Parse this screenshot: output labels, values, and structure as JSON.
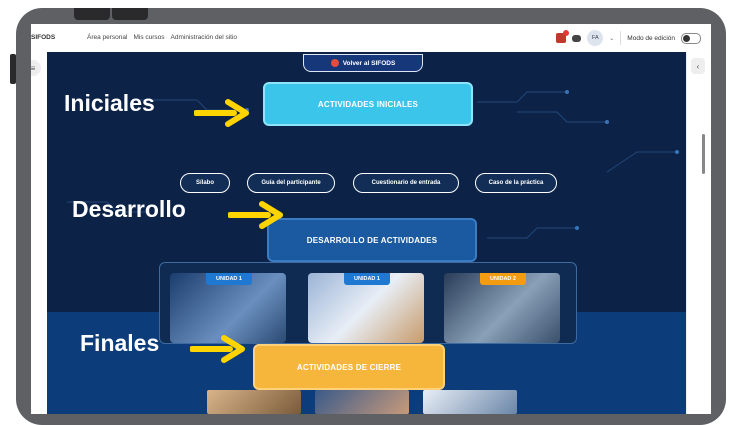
{
  "app": {
    "brand": "SIFODS"
  },
  "nav": {
    "items": [
      "Área personal",
      "Mis cursos",
      "Administración del sitio"
    ]
  },
  "header": {
    "avatar_initials": "FA",
    "edit_mode_label": "Modo de edición"
  },
  "banner": {
    "back_label": "Volver al SIFODS"
  },
  "sections": {
    "iniciales": {
      "title": "ACTIVIDADES INICIALES",
      "annotation": "Iniciales"
    },
    "desarrollo": {
      "title": "DESARROLLO DE ACTIVIDADES",
      "annotation": "Desarrollo"
    },
    "finales": {
      "title": "ACTIVIDADES DE CIERRE",
      "annotation": "Finales"
    }
  },
  "quick_links": [
    "Sílabo",
    "Guía del participante",
    "Cuestionario de entrada",
    "Caso de la práctica"
  ],
  "units": [
    {
      "label": "UNIDAD 1",
      "tag_color": "#1f78d1"
    },
    {
      "label": "UNIDAD 1",
      "tag_color": "#1f78d1"
    },
    {
      "label": "UNIDAD 2",
      "tag_color": "#f39c12"
    }
  ],
  "colors": {
    "content_bg": "#0c2347",
    "cyan": "#3cc5ea",
    "blue": "#1b5aa0",
    "yellow": "#f6b63c",
    "arrow": "#ffd400"
  }
}
